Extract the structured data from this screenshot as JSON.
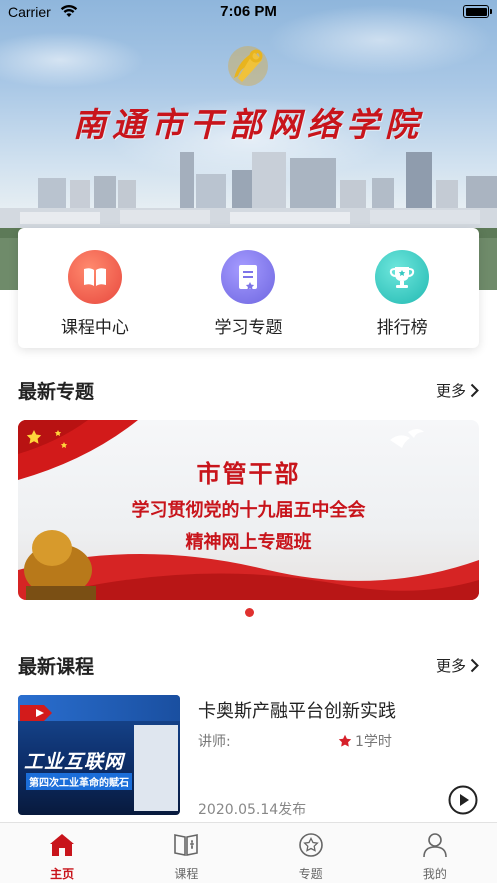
{
  "status_bar": {
    "carrier": "Carrier",
    "time": "7:06 PM"
  },
  "hero": {
    "title": "南通市干部网络学院"
  },
  "quick_nav": [
    {
      "label": "课程中心",
      "icon": "book-icon",
      "color": "#ee5a48"
    },
    {
      "label": "学习专题",
      "icon": "document-icon",
      "color": "#7d74e8"
    },
    {
      "label": "排行榜",
      "icon": "trophy-icon",
      "color": "#35c9c2"
    }
  ],
  "topics": {
    "title": "最新专题",
    "more_label": "更多",
    "banner": {
      "line1": "市管干部",
      "line2": "学习贯彻党的十九届五中全会",
      "line3": "精神网上专题班"
    }
  },
  "courses": {
    "title": "最新课程",
    "more_label": "更多",
    "items": [
      {
        "title": "卡奥斯产融平台创新实践",
        "lecturer_label": "讲师:",
        "hours": "1学时",
        "date": "2020.05.14发布",
        "thumb_title": "工业互联网",
        "thumb_subtitle": "第四次工业革命的赋石"
      }
    ]
  },
  "tabbar": [
    {
      "label": "主页",
      "icon": "home-icon",
      "active": true
    },
    {
      "label": "课程",
      "icon": "book-open-icon",
      "active": false
    },
    {
      "label": "专题",
      "icon": "star-circle-icon",
      "active": false
    },
    {
      "label": "我的",
      "icon": "person-icon",
      "active": false
    }
  ],
  "colors": {
    "accent": "#c8141b",
    "indicator": "#e0312f"
  }
}
